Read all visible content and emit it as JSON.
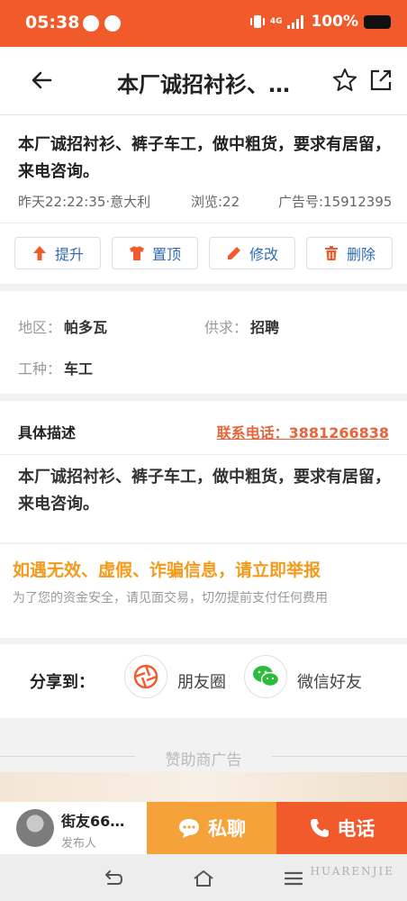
{
  "status": {
    "time": "05:38",
    "network": "4G",
    "battery": "100%"
  },
  "header": {
    "title": "本厂诚招衬衫、…"
  },
  "post": {
    "text": "本厂诚招衬衫、裤子车工，做中粗货，要求有居留，来电咨询。",
    "posted": "昨天22:22:35·意大利",
    "views": "浏览:22",
    "ad_number": "广告号:15912395"
  },
  "actions": [
    {
      "label": "提升",
      "icon": "arrow-up-icon"
    },
    {
      "label": "置顶",
      "icon": "shirt-icon"
    },
    {
      "label": "修改",
      "icon": "pencil-icon"
    },
    {
      "label": "删除",
      "icon": "trash-icon"
    }
  ],
  "info": {
    "region_label": "地区：",
    "region": "帕多瓦",
    "supply_label": "供求：",
    "supply": "招聘",
    "job_label": "工种：",
    "job": "车工"
  },
  "description": {
    "title": "具体描述",
    "phone": "联系电话：3881266838",
    "text": "本厂诚招衬衫、裤子车工，做中粗货，要求有居留，来电咨询。"
  },
  "warning": {
    "title": "如遇无效、虚假、诈骗信息，请立即举报",
    "text": "为了您的资金安全，请见面交易，切勿提前支付任何费用"
  },
  "share": {
    "label": "分享到：",
    "moments": "朋友圈",
    "wechat": "微信好友"
  },
  "sponsor": {
    "label": "赞助商广告"
  },
  "bottom": {
    "user_name": "街友66…",
    "user_role": "发布人",
    "chat": "私聊",
    "call": "电话"
  },
  "watermark": "HUARENJIE",
  "colors": {
    "accent": "#f15a2b",
    "chat": "#f6a23a",
    "link": "#2f6cb3",
    "warning": "#f39a1c"
  }
}
